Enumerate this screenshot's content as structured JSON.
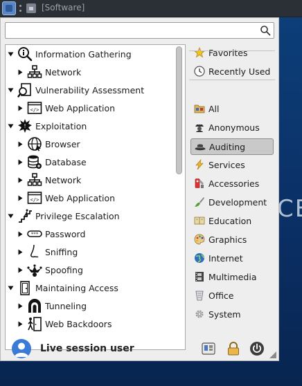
{
  "taskbar": {
    "task_title": "[Software]"
  },
  "search": {
    "placeholder": "",
    "value": ""
  },
  "tree": [
    {
      "level": 0,
      "expanded": true,
      "label": "Information Gathering",
      "icon": "magnify-info-icon"
    },
    {
      "level": 1,
      "expanded": false,
      "label": "Network",
      "icon": "network-icon"
    },
    {
      "level": 0,
      "expanded": true,
      "label": "Vulnerability Assessment",
      "icon": "magnify-document-icon"
    },
    {
      "level": 1,
      "expanded": false,
      "label": "Web Application",
      "icon": "web-code-icon"
    },
    {
      "level": 0,
      "expanded": true,
      "label": "Exploitation",
      "icon": "explosion-icon"
    },
    {
      "level": 1,
      "expanded": false,
      "label": "Browser",
      "icon": "globe-icon"
    },
    {
      "level": 1,
      "expanded": false,
      "label": "Database",
      "icon": "database-icon"
    },
    {
      "level": 1,
      "expanded": false,
      "label": "Network",
      "icon": "network-icon"
    },
    {
      "level": 1,
      "expanded": false,
      "label": "Web Application",
      "icon": "web-code-icon"
    },
    {
      "level": 0,
      "expanded": true,
      "label": "Privilege Escalation",
      "icon": "stairs-icon"
    },
    {
      "level": 1,
      "expanded": false,
      "label": "Password",
      "icon": "password-icon"
    },
    {
      "level": 1,
      "expanded": false,
      "label": "Sniffing",
      "icon": "nose-icon"
    },
    {
      "level": 1,
      "expanded": false,
      "label": "Spoofing",
      "icon": "jester-icon"
    },
    {
      "level": 0,
      "expanded": true,
      "label": "Maintaining Access",
      "icon": "door-icon"
    },
    {
      "level": 1,
      "expanded": false,
      "label": "Tunneling",
      "icon": "tunnel-icon"
    },
    {
      "level": 1,
      "expanded": false,
      "label": "Web Backdoors",
      "icon": "backdoor-icon"
    }
  ],
  "categories": [
    {
      "label": "Favorites",
      "icon": "star-icon",
      "active": false
    },
    {
      "label": "Recently Used",
      "icon": "clock-icon",
      "active": false
    },
    {
      "label": "All",
      "icon": "folder-icon",
      "active": false
    },
    {
      "label": "Anonymous",
      "icon": "spy-icon",
      "active": false
    },
    {
      "label": "Auditing",
      "icon": "hat-icon",
      "active": true
    },
    {
      "label": "Services",
      "icon": "lightning-icon",
      "active": false
    },
    {
      "label": "Accessories",
      "icon": "tools-icon",
      "active": false
    },
    {
      "label": "Development",
      "icon": "brush-icon",
      "active": false
    },
    {
      "label": "Education",
      "icon": "education-icon",
      "active": false
    },
    {
      "label": "Graphics",
      "icon": "palette-icon",
      "active": false
    },
    {
      "label": "Internet",
      "icon": "internet-globe-icon",
      "active": false
    },
    {
      "label": "Multimedia",
      "icon": "film-icon",
      "active": false
    },
    {
      "label": "Office",
      "icon": "office-icon",
      "active": false
    },
    {
      "label": "System",
      "icon": "system-gear-icon",
      "active": false
    }
  ],
  "footer": {
    "user_name": "Live session user"
  },
  "background": {
    "deco_text": "CE"
  },
  "colors": {
    "accent": "#3a7bd5",
    "active_category_bg": "#c9c9c9",
    "desktop_bg": "#0a2f64"
  }
}
